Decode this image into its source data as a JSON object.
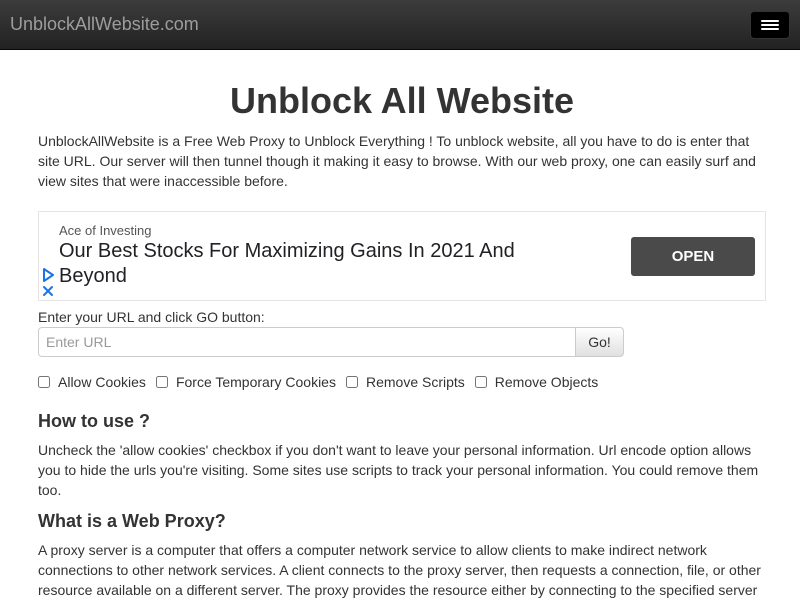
{
  "navbar": {
    "brand": "UnblockAllWebsite.com",
    "menu_icon": "hamburger-menu-icon"
  },
  "main": {
    "title": "Unblock All Website",
    "intro": "UnblockAllWebsite is a Free Web Proxy to Unblock Everything ! To unblock website, all you have to do is enter that site URL. Our server will then tunnel though it making it easy to browse. With our web proxy, one can easily surf and view sites that were inaccessible before."
  },
  "ad": {
    "source": "Ace of Investing",
    "headline": "Our Best Stocks For Maximizing Gains In 2021 And Beyond",
    "cta": "OPEN",
    "play_icon": "adchoices-play-icon",
    "close_icon": "ad-close-icon",
    "icon_color": "#1a73e8"
  },
  "form": {
    "label": "Enter your URL and click GO button:",
    "url_placeholder": "Enter URL",
    "url_value": "",
    "go_label": "Go!",
    "options": [
      {
        "label": "Allow Cookies",
        "checked": false
      },
      {
        "label": "Force Temporary Cookies",
        "checked": false
      },
      {
        "label": "Remove Scripts",
        "checked": false
      },
      {
        "label": "Remove Objects",
        "checked": false
      }
    ]
  },
  "sections": [
    {
      "heading": "How to use ?",
      "text": "Uncheck the 'allow cookies' checkbox if you don't want to leave your personal information. Url encode option allows you to hide the urls you're visiting. Some sites use scripts to track your personal information. You could remove them too."
    },
    {
      "heading": "What is a Web Proxy?",
      "text": "A proxy server is a computer that offers a computer network service to allow clients to make indirect network connections to other network services. A client connects to the proxy server, then requests a connection, file, or other resource available on a different server. The proxy provides the resource either by connecting to the specified server"
    }
  ]
}
